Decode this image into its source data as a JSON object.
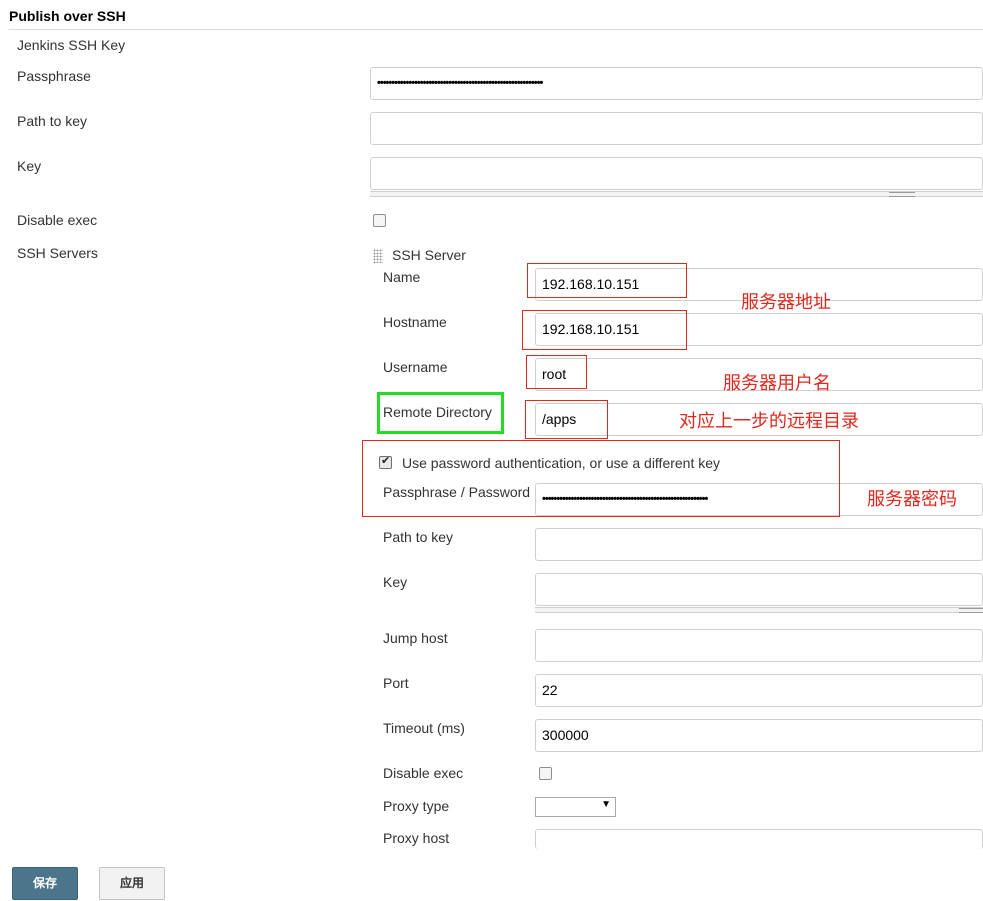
{
  "section": {
    "title": "Publish over SSH"
  },
  "global": {
    "jenkins_ssh_key_label": "Jenkins SSH Key",
    "passphrase_label": "Passphrase",
    "passphrase_value": "••••••••••••••••••••••••••••••••••••••••••••••••••••••••••",
    "path_to_key_label": "Path to key",
    "path_to_key_value": "",
    "key_label": "Key",
    "key_value": "",
    "disable_exec_label": "Disable exec",
    "disable_exec_checked": false,
    "ssh_servers_label": "SSH Servers"
  },
  "server": {
    "header": "SSH Server",
    "name_label": "Name",
    "name_value": "192.168.10.151",
    "hostname_label": "Hostname",
    "hostname_value": "192.168.10.151",
    "username_label": "Username",
    "username_value": "root",
    "remote_dir_label": "Remote Directory",
    "remote_dir_value": "/apps",
    "use_password_label": "Use password authentication, or use a different key",
    "use_password_checked": true,
    "pass_label": "Passphrase / Password",
    "pass_value": "••••••••••••••••••••••••••••••••••••••••••••••••••••••••••",
    "path_to_key_label": "Path to key",
    "path_to_key_value": "",
    "key_label": "Key",
    "key_value": "",
    "jump_host_label": "Jump host",
    "jump_host_value": "",
    "port_label": "Port",
    "port_value": "22",
    "timeout_label": "Timeout (ms)",
    "timeout_value": "300000",
    "disable_exec_label": "Disable exec",
    "disable_exec_checked": false,
    "proxy_type_label": "Proxy type",
    "proxy_type_value": "",
    "proxy_host_label": "Proxy host",
    "proxy_host_value": ""
  },
  "annotations": {
    "server_address": "服务器地址",
    "server_username": "服务器用户名",
    "remote_dir_note": "对应上一步的远程目录",
    "server_password": "服务器密码"
  },
  "buttons": {
    "save": "保存",
    "apply": "应用"
  },
  "colors": {
    "annotation_red": "#e0281e",
    "highlight_green": "#22dd22",
    "primary_button": "#4b758b"
  }
}
